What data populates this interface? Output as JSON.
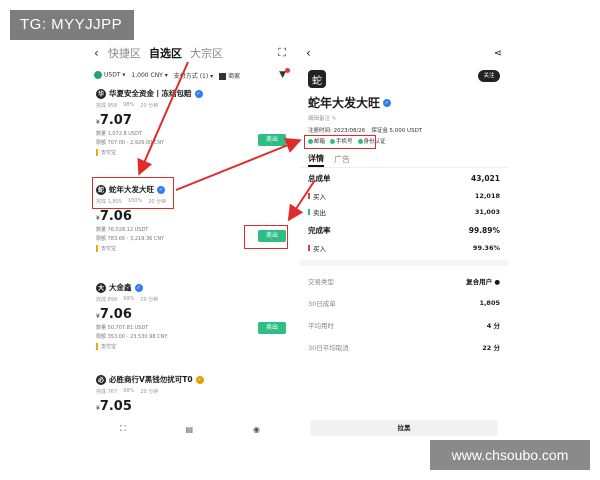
{
  "badges": {
    "tg": "TG: MYYJJPP",
    "watermark": "www.chsoubo.com"
  },
  "left": {
    "nav": {
      "back": "‹",
      "tabs": [
        "快捷区",
        "自选区",
        "大宗区"
      ],
      "active_tab": 1,
      "scan": "⛶"
    },
    "filters": {
      "coin": "USDT",
      "amount": "1,000 CNY",
      "pay": "支付方式 (1)",
      "check_label": "商家",
      "funnel": "▼"
    },
    "merchants": [
      {
        "avatar": "华",
        "name": "华夏安全资金丨冻结包赔",
        "stats": [
          "完成 958",
          "98%",
          "20 分钟"
        ],
        "price": "7.07",
        "limit": "数量 1,072.8 USDT",
        "range": "限额 707.00 - 2,926.00 CNY",
        "pay": "支付宝",
        "sell": "卖出"
      },
      {
        "avatar": "蛇",
        "name": "蛇年大发大旺",
        "stats": [
          "完成 1,805",
          "100%",
          "20 分钟"
        ],
        "price": "7.06",
        "limit": "数量 76,028.12 USDT",
        "range": "限额 783.66 - 3,219.36 CNY",
        "pay": "支付宝",
        "sell": "卖出"
      },
      {
        "avatar": "大",
        "name": "大金鑫",
        "stats": [
          "完成 898",
          "99%",
          "20 分钟"
        ],
        "price": "7.06",
        "limit": "数量 50,707.81 USDT",
        "range": "限额 353.00 - 23,530.98 CNY",
        "pay": "支付宝",
        "sell": "卖出"
      },
      {
        "avatar": "必",
        "name": "必胜商行V黑钱勿扰可T0",
        "stats": [
          "完成 767",
          "98%",
          "20 分钟"
        ],
        "price": "7.05",
        "limit": "",
        "range": "",
        "pay": "",
        "sell": ""
      }
    ],
    "bottom": [
      "⛶",
      "▤",
      "◉"
    ]
  },
  "right": {
    "nav": {
      "back": "‹",
      "share": "⋖"
    },
    "avatar": "蛇",
    "follow": "关注",
    "name": "蛇年大发大旺",
    "sub": "编辑备注 ✎",
    "reg_date": "注册时间: 2023/08/26",
    "deposit": "保证金 5,000 USDT",
    "checks": [
      "邮箱",
      "手机号",
      "身份认证"
    ],
    "tabs": [
      "详情",
      "广告"
    ],
    "total_label": "总成单",
    "total_value": "43,021",
    "buy_label": "买入",
    "buy_value": "12,018",
    "sell_label": "卖出",
    "sell_value": "31,003",
    "rate_label": "完成率",
    "rate_value": "99.89%",
    "rate_buy_label": "买入",
    "rate_buy_value": "99.36%",
    "info": [
      {
        "label": "交易类型",
        "value": "复合用户 ●"
      },
      {
        "label": "30日成单",
        "value": "1,805"
      },
      {
        "label": "平均用时",
        "value": "4 分"
      },
      {
        "label": "30日平均取消",
        "value": "22 分"
      }
    ],
    "block": "拉黑"
  }
}
